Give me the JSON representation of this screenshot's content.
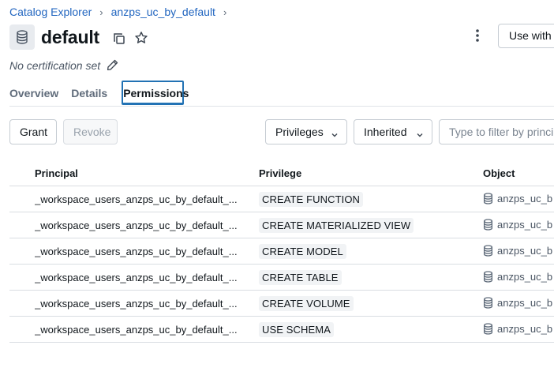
{
  "breadcrumb": {
    "items": [
      "Catalog Explorer",
      "anzps_uc_by_default"
    ],
    "separator": "›"
  },
  "header": {
    "title": "default",
    "icon": "database-schema-icon",
    "actions": {
      "use_with_label": "Use with I"
    }
  },
  "certification": {
    "text": "No certification set"
  },
  "tabs": [
    {
      "label": "Overview",
      "active": false
    },
    {
      "label": "Details",
      "active": false
    },
    {
      "label": "Permissions",
      "active": true
    }
  ],
  "toolbar": {
    "grant_label": "Grant",
    "revoke_label": "Revoke",
    "privileges_label": "Privileges",
    "inherited_label": "Inherited",
    "filter_placeholder": "Type to filter by principal"
  },
  "table": {
    "columns": [
      "Principal",
      "Privilege",
      "Object"
    ],
    "rows": [
      {
        "principal": "_workspace_users_anzps_uc_by_default_...",
        "privilege": "CREATE FUNCTION",
        "object": "anzps_uc_b"
      },
      {
        "principal": "_workspace_users_anzps_uc_by_default_...",
        "privilege": "CREATE MATERIALIZED VIEW",
        "object": "anzps_uc_b"
      },
      {
        "principal": "_workspace_users_anzps_uc_by_default_...",
        "privilege": "CREATE MODEL",
        "object": "anzps_uc_b"
      },
      {
        "principal": "_workspace_users_anzps_uc_by_default_...",
        "privilege": "CREATE TABLE",
        "object": "anzps_uc_b"
      },
      {
        "principal": "_workspace_users_anzps_uc_by_default_...",
        "privilege": "CREATE VOLUME",
        "object": "anzps_uc_b"
      },
      {
        "principal": "_workspace_users_anzps_uc_by_default_...",
        "privilege": "USE SCHEMA",
        "object": "anzps_uc_b"
      }
    ]
  },
  "colors": {
    "link": "#2266c0",
    "tab_active_border": "#2272b4",
    "border": "#c6ccd3",
    "tag_bg": "#f1f3f5"
  }
}
